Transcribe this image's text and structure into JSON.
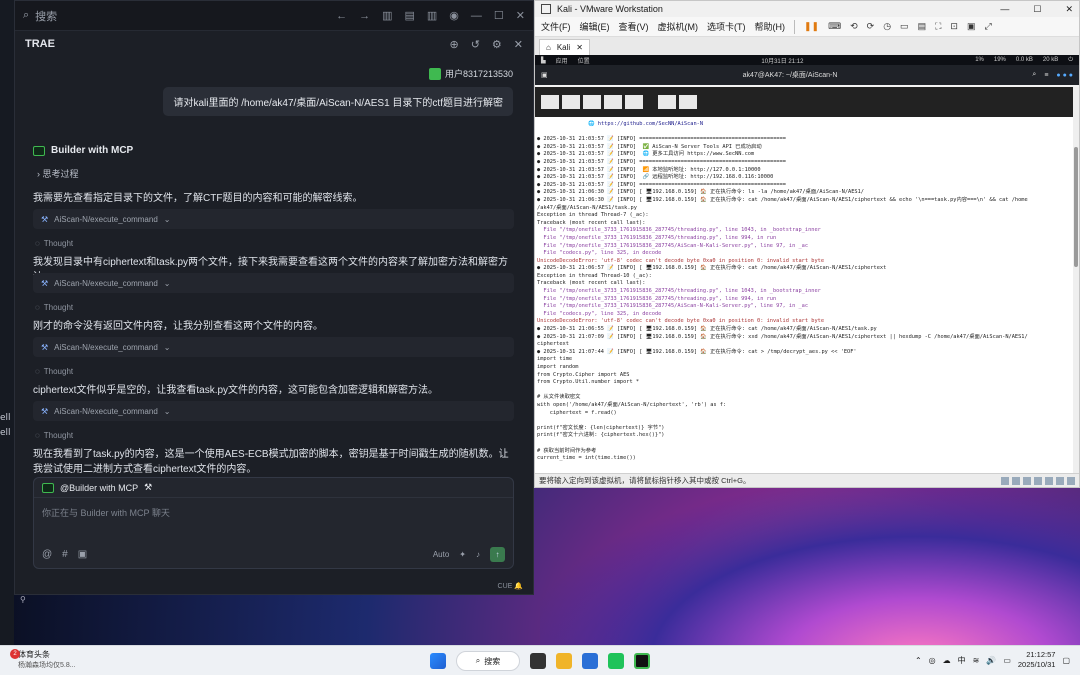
{
  "left_strip": {
    "labels": [
      "ell",
      "ell"
    ]
  },
  "trae": {
    "search_label": "搜索",
    "title": "TRAE",
    "user_name": "用户8317213530",
    "user_message": "请对kali里面的 /home/ak47/桌面/AiScan-N/AES1 目录下的ctf题目进行解密",
    "agent_name": "Builder with MCP",
    "process_label": "思考过程",
    "tool_name": "AiScan-N/execute_command",
    "thought_label": "Thought",
    "messages": [
      "我需要先查看指定目录下的文件，了解CTF题目的内容和可能的解密线索。",
      "我发现目录中有ciphertext和task.py两个文件，接下来我需要查看这两个文件的内容来了解加密方法和解密方法。",
      "刚才的命令没有返回文件内容，让我分别查看这两个文件的内容。",
      "ciphertext文件似乎是空的，让我查看task.py文件的内容，这可能包含加密逻辑和解密方法。",
      "现在我看到了task.py的内容，这是一个使用AES-ECB模式加密的脚本，密钥是基于时间戳生成的随机数。让我尝试使用二进制方式查看ciphertext文件的内容。"
    ],
    "composer": {
      "header": "@Builder with MCP",
      "placeholder": "你正在与 Builder with MCP 聊天",
      "mode": "Auto"
    },
    "footer": "CUE"
  },
  "vmware": {
    "title": "Kali - VMware Workstation",
    "menu": [
      "文件(F)",
      "编辑(E)",
      "查看(V)",
      "虚拟机(M)",
      "选项卡(T)",
      "帮助(H)"
    ],
    "tab": "Kali",
    "kali_bar": {
      "apps": "应用",
      "places": "位置",
      "datetime": "10月31日 21:12",
      "cpu": "1%",
      "mem": "19%",
      "net_down": "0.0 kB",
      "net_up": "20 kB"
    },
    "terminal_title": "ak47@AK47: ~/桌面/AiScan-N",
    "terminal_lines": [
      {
        "text": "                🌐 https://github.com/SecNN/AiScan-N",
        "cls": "link"
      },
      {
        "text": "",
        "cls": ""
      },
      {
        "text": "● 2025-10-31 21:03:57 📝 [INFO] ==============================================",
        "cls": ""
      },
      {
        "text": "● 2025-10-31 21:03:57 📝 [INFO]  ✅ AiScan-N Server Tools API 已成功启动",
        "cls": ""
      },
      {
        "text": "● 2025-10-31 21:03:57 📝 [INFO]  🌐 更多工具访问 https://www.SecNN.com",
        "cls": ""
      },
      {
        "text": "● 2025-10-31 21:03:57 📝 [INFO] ==============================================",
        "cls": ""
      },
      {
        "text": "● 2025-10-31 21:03:57 📝 [INFO]  📶 本地监听地址: http://127.0.0.1:10000",
        "cls": ""
      },
      {
        "text": "● 2025-10-31 21:03:57 📝 [INFO]  🔗 远程监听地址: http://192.168.0.116:10000",
        "cls": ""
      },
      {
        "text": "● 2025-10-31 21:03:57 📝 [INFO] ==============================================",
        "cls": ""
      },
      {
        "text": "● 2025-10-31 21:06:30 📝 [INFO] [ 🖥192.168.0.159] 🏠 正在执行命令: ls -la /home/ak47/桌面/AiScan-N/AES1/",
        "cls": ""
      },
      {
        "text": "● 2025-10-31 21:06:30 📝 [INFO] [ 🖥192.168.0.159] 🏠 正在执行命令: cat /home/ak47/桌面/AiScan-N/AES1/ciphertext && echo '\\n===task.py内容===\\n' && cat /home",
        "cls": ""
      },
      {
        "text": "/ak47/桌面/AiScan-N/AES1/task.py",
        "cls": ""
      },
      {
        "text": "Exception in thread Thread-7 (_ac):",
        "cls": ""
      },
      {
        "text": "Traceback (most recent call last):",
        "cls": ""
      },
      {
        "text": "  File \"/tmp/onefile_3733_1761915836_287745/threading.py\", line 1043, in _bootstrap_inner",
        "cls": "purple"
      },
      {
        "text": "  File \"/tmp/onefile_3733_1761915836_287745/threading.py\", line 994, in run",
        "cls": "purple"
      },
      {
        "text": "  File \"/tmp/onefile_3733_1761915836_287745/AiScan-N-Kali-Server.py\", line 97, in _ac",
        "cls": "purple"
      },
      {
        "text": "  File \"codecs.py\", line 325, in decode",
        "cls": "purple"
      },
      {
        "text": "UnicodeDecodeError: 'utf-8' codec can't decode byte 0xa0 in position 0: invalid start byte",
        "cls": "red"
      },
      {
        "text": "● 2025-10-31 21:06:57 📝 [INFO] [ 🖥192.168.0.159] 🏠 正在执行命令: cat /home/ak47/桌面/AiScan-N/AES1/ciphertext",
        "cls": ""
      },
      {
        "text": "Exception in thread Thread-10 (_ac):",
        "cls": ""
      },
      {
        "text": "Traceback (most recent call last):",
        "cls": ""
      },
      {
        "text": "  File \"/tmp/onefile_3733_1761915836_287745/threading.py\", line 1043, in _bootstrap_inner",
        "cls": "purple"
      },
      {
        "text": "  File \"/tmp/onefile_3733_1761915836_287745/threading.py\", line 994, in run",
        "cls": "purple"
      },
      {
        "text": "  File \"/tmp/onefile_3733_1761915836_287745/AiScan-N-Kali-Server.py\", line 97, in _ac",
        "cls": "purple"
      },
      {
        "text": "  File \"codecs.py\", line 325, in decode",
        "cls": "purple"
      },
      {
        "text": "UnicodeDecodeError: 'utf-8' codec can't decode byte 0xa0 in position 0: invalid start byte",
        "cls": "red"
      },
      {
        "text": "● 2025-10-31 21:06:55 📝 [INFO] [ 🖥192.168.0.159] 🏠 正在执行命令: cat /home/ak47/桌面/AiScan-N/AES1/task.py",
        "cls": ""
      },
      {
        "text": "● 2025-10-31 21:07:09 📝 [INFO] [ 🖥192.168.0.159] 🏠 正在执行命令: xxd /home/ak47/桌面/AiScan-N/AES1/ciphertext || hexdump -C /home/ak47/桌面/AiScan-N/AES1/",
        "cls": ""
      },
      {
        "text": "ciphertext",
        "cls": ""
      },
      {
        "text": "● 2025-10-31 21:07:44 📝 [INFO] [ 🖥192.168.0.159] 🏠 正在执行命令: cat > /tmp/decrypt_aes.py << 'EOF'",
        "cls": ""
      },
      {
        "text": "import time",
        "cls": ""
      },
      {
        "text": "import random",
        "cls": ""
      },
      {
        "text": "from Crypto.Cipher import AES",
        "cls": ""
      },
      {
        "text": "from Crypto.Util.number import *",
        "cls": ""
      },
      {
        "text": "",
        "cls": ""
      },
      {
        "text": "# 从文件读取密文",
        "cls": ""
      },
      {
        "text": "with open('/home/ak47/桌面/AiScan-N/ciphertext', 'rb') as f:",
        "cls": ""
      },
      {
        "text": "    ciphertext = f.read()",
        "cls": ""
      },
      {
        "text": "",
        "cls": ""
      },
      {
        "text": "print(f\"密文长度: {len(ciphertext)} 字节\")",
        "cls": ""
      },
      {
        "text": "print(f\"密文十六进制: {ciphertext.hex()}\")",
        "cls": ""
      },
      {
        "text": "",
        "cls": ""
      },
      {
        "text": "# 获取当前时间作为参考",
        "cls": ""
      },
      {
        "text": "current_time = int(time.time())",
        "cls": ""
      }
    ],
    "status": "要将输入定向到该虚拟机，请将鼠标指针移入其中或按 Ctrl+G。"
  },
  "taskbar": {
    "news_title": "体育头条",
    "news_sub": "杨瀚森场均仅5.8...",
    "news_badge": "2",
    "search": "搜索",
    "ime": "中",
    "time": "21:12:57",
    "date": "2025/10/31"
  }
}
